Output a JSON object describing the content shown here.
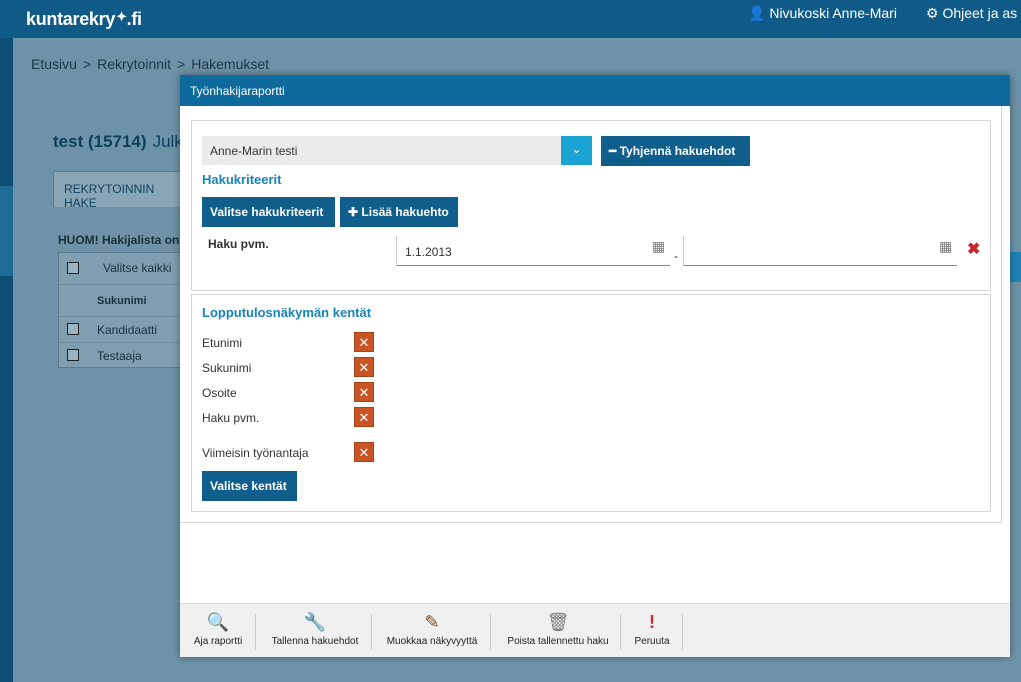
{
  "topbar": {
    "logo_text": "kuntarekry",
    "logo_tld": ".fi",
    "user_name": "Nivukoski Anne-Mari",
    "help_label": "Ohjeet ja as"
  },
  "breadcrumb": [
    "Etusivu",
    "Rekrytoinnit",
    "Hakemukset"
  ],
  "breadcrumb_sep": ">",
  "background": {
    "title": "test (15714)",
    "title_suffix": "Julk",
    "tab_label": "REKRYTOINNIN HAKE",
    "note": "HUOM! Hakijalista on s",
    "select_all": "Valitse kaikki",
    "col_header": "Sukunimi",
    "rows": [
      "Kandidaatti",
      "Testaaja"
    ]
  },
  "modal": {
    "title": "Työnhakijaraportti",
    "saved_search_value": "Anne-Marin testi",
    "clear_button": "Tyhjennä hakuehdot",
    "criteria_title": "Hakukriteerit",
    "select_criteria_button": "Valitse hakukriteerit",
    "add_criterion_button": "Lisää hakuehto",
    "criterion_label": "Haku pvm.",
    "date_from": "1.1.2013",
    "date_to": "",
    "date_sep": "-",
    "result_fields_title": "Lopputulosnäkymän kentät",
    "result_fields": [
      "Etunimi",
      "Sukunimi",
      "Osoite",
      "Haku pvm.",
      "Viimeisin työnantaja"
    ],
    "select_fields_button": "Valitse kentät"
  },
  "footer": {
    "buttons": [
      {
        "label": "Aja raportti",
        "icon": "report-icon"
      },
      {
        "label": "Tallenna hakuehdot",
        "icon": "wrench-icon"
      },
      {
        "label": "Muokkaa näkyvyyttä",
        "icon": "edit-icon"
      },
      {
        "label": "Poista tallennettu haku",
        "icon": "trash-icon"
      },
      {
        "label": "Peruuta",
        "icon": "exclamation-icon"
      }
    ]
  },
  "colors": {
    "header_blue": "#0e6a9c",
    "button_blue": "#0f5e8c",
    "title_blue": "#1884b8",
    "remove_orange": "#c95425",
    "delete_red": "#c8242a"
  }
}
